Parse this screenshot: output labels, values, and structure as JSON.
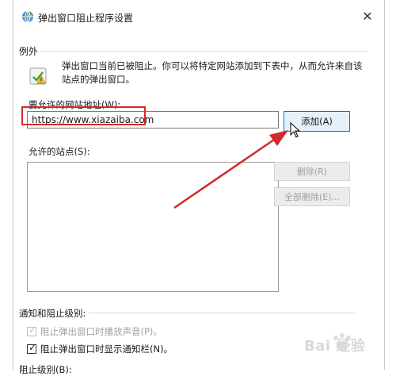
{
  "window": {
    "title": "弹出窗口阻止程序设置",
    "close_glyph": "✕",
    "title_icon": "ie-globe-icon"
  },
  "exceptions": {
    "group_label": "例外",
    "icon": "shield-warning-icon",
    "description": "弹出窗口当前已被阻止。你可以将特定网站添加到下表中，从而允许来自该站点的弹出窗口。",
    "address_label": "要允许的网站地址(W):",
    "address_value": "https://www.xiazaiba.com",
    "add_button": "添加(A)",
    "allowed_sites_label": "允许的站点(S):",
    "allowed_sites": [],
    "remove_button": "删除(R)",
    "remove_all_button": "全部删除(E)..."
  },
  "notifications": {
    "group_label": "通知和阻止级别:",
    "play_sound": {
      "label": "阻止弹出窗口时播放声音(P)。",
      "checked": true,
      "enabled": false
    },
    "show_bar": {
      "label": "阻止弹出窗口时显示通知栏(N)。",
      "checked": true,
      "enabled": true
    },
    "level_label": "阻止级别(B):"
  },
  "annotations": {
    "highlight_color": "#d32a2a",
    "arrow_color": "#d32a2a"
  },
  "watermark": {
    "text": "Bai 经验",
    "icon": "baidu-paw-icon"
  }
}
